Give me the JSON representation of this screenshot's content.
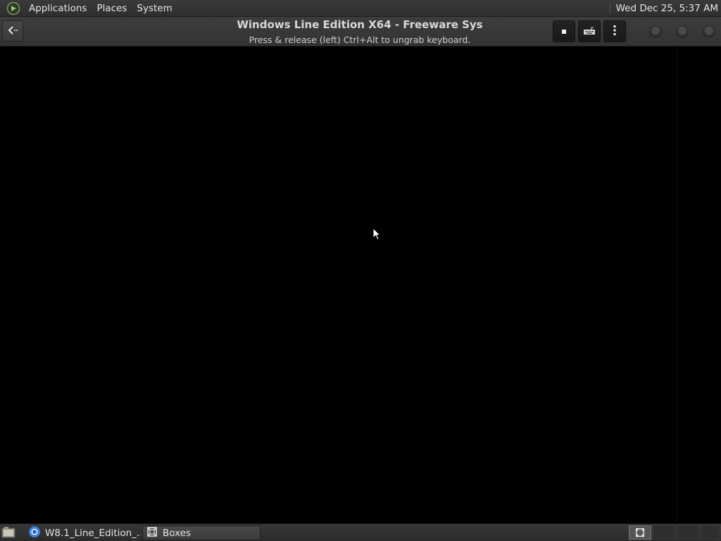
{
  "top_panel": {
    "menus": [
      "Applications",
      "Places",
      "System"
    ],
    "clock": "Wed Dec 25,  5:37 AM"
  },
  "headerbar": {
    "title": "Windows Line Edition X64 - Freeware Sys",
    "subtitle": "Press & release (left) Ctrl+Alt to ungrab keyboard."
  },
  "taskbar": {
    "items": [
      {
        "label": "W8.1_Line_Edition_...",
        "icon": "chromium-icon"
      },
      {
        "label": "Boxes",
        "icon": "boxes-icon"
      }
    ]
  },
  "icons": {
    "logo": "mate-logo-icon",
    "back": "back-arrow-icon",
    "stop": "stop-icon",
    "keyboard": "keyboard-icon",
    "menu": "kebab-menu-icon"
  },
  "colors": {
    "panel_bg": "#2e2e2e",
    "headerbar_bg": "#383838",
    "vm_bg": "#000000",
    "text": "#e6e6e6"
  }
}
